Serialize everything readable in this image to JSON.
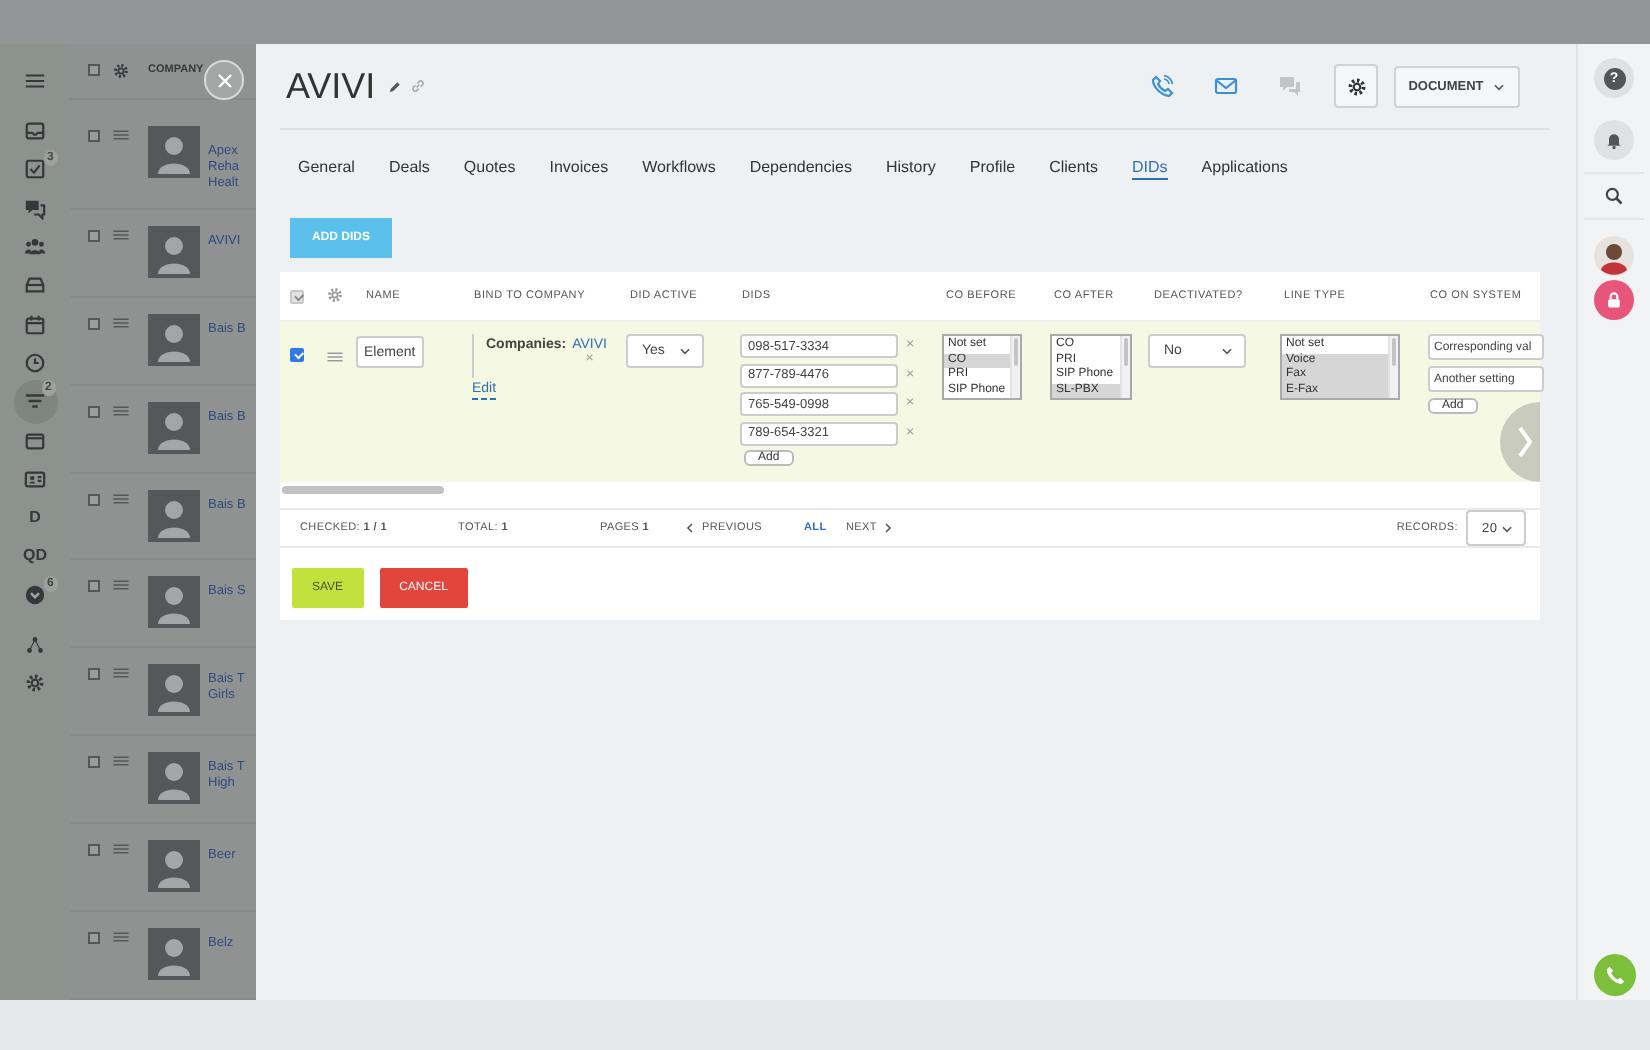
{
  "backdrop": {
    "nav": [
      {
        "kind": "menu",
        "selected": false
      },
      {
        "kind": "icon",
        "selected": false
      },
      {
        "kind": "icon",
        "badge": "3",
        "selected": false
      },
      {
        "kind": "icon",
        "selected": false
      },
      {
        "kind": "icon",
        "selected": false
      },
      {
        "kind": "icon",
        "selected": false
      },
      {
        "kind": "icon",
        "selected": false
      },
      {
        "kind": "icon",
        "selected": false
      },
      {
        "kind": "icon",
        "badge": "2",
        "selected": true
      },
      {
        "kind": "icon",
        "selected": false
      },
      {
        "kind": "icon",
        "selected": false
      },
      {
        "kind": "letter",
        "label": "D",
        "selected": false
      },
      {
        "kind": "letter",
        "label": "QD",
        "selected": false
      },
      {
        "kind": "icon",
        "badge": "6",
        "selected": false
      },
      {
        "kind": "icon",
        "selected": false
      },
      {
        "kind": "icon",
        "selected": false
      }
    ],
    "list": {
      "header": "COMPANY",
      "header_checked": false,
      "rows": [
        {
          "name": "Apex Reha Healt",
          "checked": false
        },
        {
          "name": "AVIVI",
          "checked": false
        },
        {
          "name": "Bais B",
          "checked": false
        },
        {
          "name": "Bais B",
          "checked": false
        },
        {
          "name": "Bais B",
          "checked": false
        },
        {
          "name": "Bais S",
          "checked": false
        },
        {
          "name": "Bais T Girls",
          "checked": false
        },
        {
          "name": "Bais T High",
          "checked": false
        },
        {
          "name": "Beer",
          "checked": false
        },
        {
          "name": "Belz",
          "checked": false
        }
      ]
    }
  },
  "modal": {
    "title": "AVIVI",
    "header_button": "DOCUMENT",
    "tabs": [
      {
        "label": "General",
        "selected": false
      },
      {
        "label": "Deals",
        "selected": false
      },
      {
        "label": "Quotes",
        "selected": false
      },
      {
        "label": "Invoices",
        "selected": false
      },
      {
        "label": "Workflows",
        "selected": false
      },
      {
        "label": "Dependencies",
        "selected": false
      },
      {
        "label": "History",
        "selected": false
      },
      {
        "label": "Profile",
        "selected": false
      },
      {
        "label": "Clients",
        "selected": false
      },
      {
        "label": "DIDs",
        "selected": true
      },
      {
        "label": "Applications",
        "selected": false
      }
    ],
    "add_button": "ADD DIDS",
    "table": {
      "header_checkbox": {
        "checked": true,
        "disabled": true
      },
      "columns": [
        "NAME",
        "BIND TO COMPANY",
        "DID ACTIVE",
        "DIDS",
        "CO BEFORE",
        "CO AFTER",
        "DEACTIVATED?",
        "LINE TYPE",
        "CO ON SYSTEM"
      ],
      "rows": [
        {
          "checked": true,
          "name": "Element",
          "company_label": "Companies:",
          "company": "AVIVI",
          "company_remove": "×",
          "edit": "Edit",
          "did_active": "Yes",
          "dids": [
            {
              "number": "098-517-3334",
              "remove": "×"
            },
            {
              "number": "877-789-4476",
              "remove": "×"
            },
            {
              "number": "765-549-0998",
              "remove": "×"
            },
            {
              "number": "789-654-3321",
              "remove": "×"
            }
          ],
          "dids_add": "Add",
          "co_before": [
            {
              "label": "Not set",
              "selected": false
            },
            {
              "label": "CO",
              "selected": true
            },
            {
              "label": "PRI",
              "selected": false
            },
            {
              "label": "SIP Phone",
              "selected": false
            }
          ],
          "co_after": [
            {
              "label": "CO",
              "selected": false
            },
            {
              "label": "PRI",
              "selected": false
            },
            {
              "label": "SIP Phone",
              "selected": false
            },
            {
              "label": "SL-PBX",
              "selected": true
            }
          ],
          "deactivated": "No",
          "line_type": [
            {
              "label": "Not set",
              "selected": false
            },
            {
              "label": "Voice",
              "selected": true
            },
            {
              "label": "Fax",
              "selected": true
            },
            {
              "label": "E-Fax",
              "selected": true
            }
          ],
          "co_on_system": [
            "Corresponding val",
            "Another setting"
          ],
          "co_on_system_add": "Add"
        }
      ]
    },
    "footer": {
      "checked": "CHECKED: **1 / 1**",
      "total": "TOTAL: **1**",
      "pages": "PAGES **1**",
      "previous": "PREVIOUS",
      "all": "ALL",
      "next": "NEXT",
      "records_label": "RECORDS:",
      "records_value": "20"
    },
    "actions": [
      {
        "label": "SAVE",
        "kind": "save"
      },
      {
        "label": "CANCEL",
        "kind": "cancel"
      }
    ]
  },
  "right_bar": {
    "help": "?"
  }
}
